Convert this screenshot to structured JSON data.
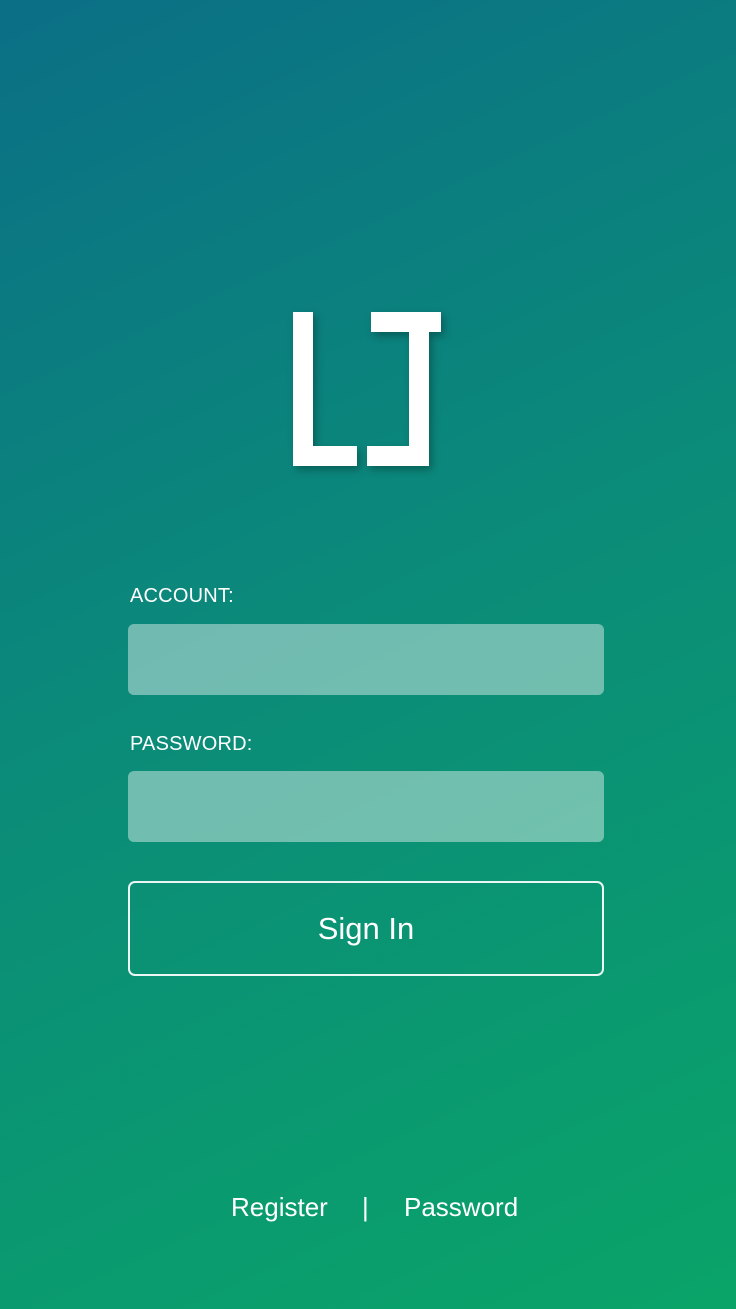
{
  "logo": {
    "icon": "brackets-logo-icon",
    "color": "#ffffff"
  },
  "form": {
    "account_label": "ACCOUNT:",
    "account_value": "",
    "account_placeholder": "",
    "password_label": "PASSWORD:",
    "password_value": "",
    "password_placeholder": "",
    "sign_in_label": "Sign In"
  },
  "footer": {
    "register_label": "Register",
    "divider": "|",
    "password_label": "Password"
  },
  "colors": {
    "background_start": "#0b6f86",
    "background_end": "#0aa468",
    "text": "#ffffff",
    "input_fill": "rgba(255,255,255,0.42)"
  }
}
